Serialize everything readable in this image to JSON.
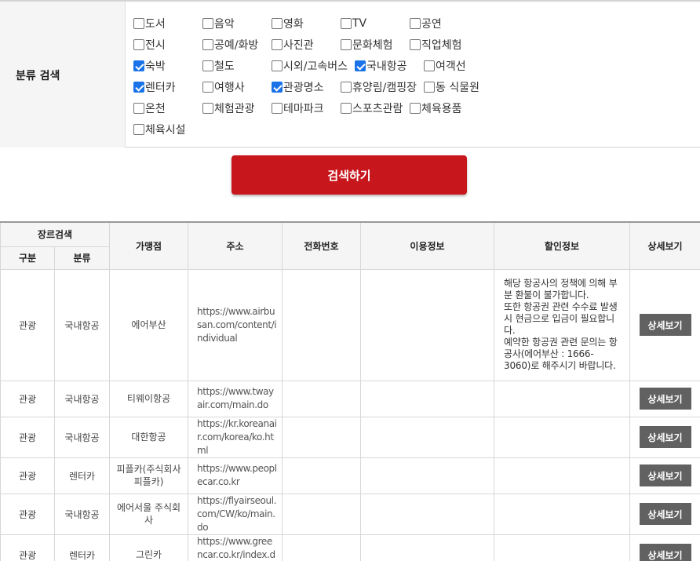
{
  "filter": {
    "label": "분류 검색",
    "options": [
      {
        "label": "도서",
        "checked": false
      },
      {
        "label": "음악",
        "checked": false
      },
      {
        "label": "영화",
        "checked": false
      },
      {
        "label": "TV",
        "checked": false
      },
      {
        "label": "공연",
        "checked": false
      },
      {
        "label": "전시",
        "checked": false
      },
      {
        "label": "공예/화방",
        "checked": false
      },
      {
        "label": "사진관",
        "checked": false
      },
      {
        "label": "문화체험",
        "checked": false
      },
      {
        "label": "직업체험",
        "checked": false
      },
      {
        "label": "숙박",
        "checked": true
      },
      {
        "label": "철도",
        "checked": false
      },
      {
        "label": "시외/고속버스",
        "checked": false
      },
      {
        "label": "국내항공",
        "checked": true
      },
      {
        "label": "여객선",
        "checked": false
      },
      {
        "label": "렌터카",
        "checked": true
      },
      {
        "label": "여행사",
        "checked": false
      },
      {
        "label": "관광명소",
        "checked": true
      },
      {
        "label": "휴양림/캠핑장",
        "checked": false
      },
      {
        "label": "동 식물원",
        "checked": false
      },
      {
        "label": "온천",
        "checked": false
      },
      {
        "label": "체험관광",
        "checked": false
      },
      {
        "label": "테마파크",
        "checked": false
      },
      {
        "label": "스포츠관람",
        "checked": false
      },
      {
        "label": "체육용품",
        "checked": false
      },
      {
        "label": "체육시설",
        "checked": false
      }
    ]
  },
  "search_button": "검색하기",
  "table": {
    "headers": {
      "genre_search": "장르검색",
      "gubun": "구분",
      "category": "분류",
      "merchant": "가맹점",
      "address": "주소",
      "phone": "전화번호",
      "usage": "이용정보",
      "discount": "할인정보",
      "detail": "상세보기"
    },
    "rows": [
      {
        "gubun": "관광",
        "category": "국내항공",
        "merchant": "에어부산",
        "address": "https://www.airbusan.com/content/individual",
        "phone": "",
        "usage": "",
        "discount": "해당 항공사의 정책에 의해 부분 환불이 불가합니다.\n또한 항공권 관련 수수료 발생 시 현금으로 입금이 필요합니다.\n예약한 항공권 관련 문의는 항공사(에어부산 : 1666-3060)로 해주시기 바랍니다.",
        "detail": "상세보기"
      },
      {
        "gubun": "관광",
        "category": "국내항공",
        "merchant": "티웨이항공",
        "address": "https://www.twayair.com/main.do",
        "phone": "",
        "usage": "",
        "discount": "",
        "detail": "상세보기"
      },
      {
        "gubun": "관광",
        "category": "국내항공",
        "merchant": "대한항공",
        "address": "https://kr.koreanair.com/korea/ko.html",
        "phone": "",
        "usage": "",
        "discount": "",
        "detail": "상세보기"
      },
      {
        "gubun": "관광",
        "category": "렌터카",
        "merchant": "피플카(주식회사 피플카)",
        "address": "https://www.peoplecar.co.kr",
        "phone": "",
        "usage": "",
        "discount": "",
        "detail": "상세보기"
      },
      {
        "gubun": "관광",
        "category": "국내항공",
        "merchant": "에어서울 주식회사",
        "address": "https://flyairseoul.com/CW/ko/main.do",
        "phone": "",
        "usage": "",
        "discount": "",
        "detail": "상세보기"
      },
      {
        "gubun": "관광",
        "category": "렌터카",
        "merchant": "그린카",
        "address": "https://www.greencar.co.kr/index.do",
        "phone": "",
        "usage": "",
        "discount": "",
        "detail": "상세보기"
      }
    ]
  }
}
